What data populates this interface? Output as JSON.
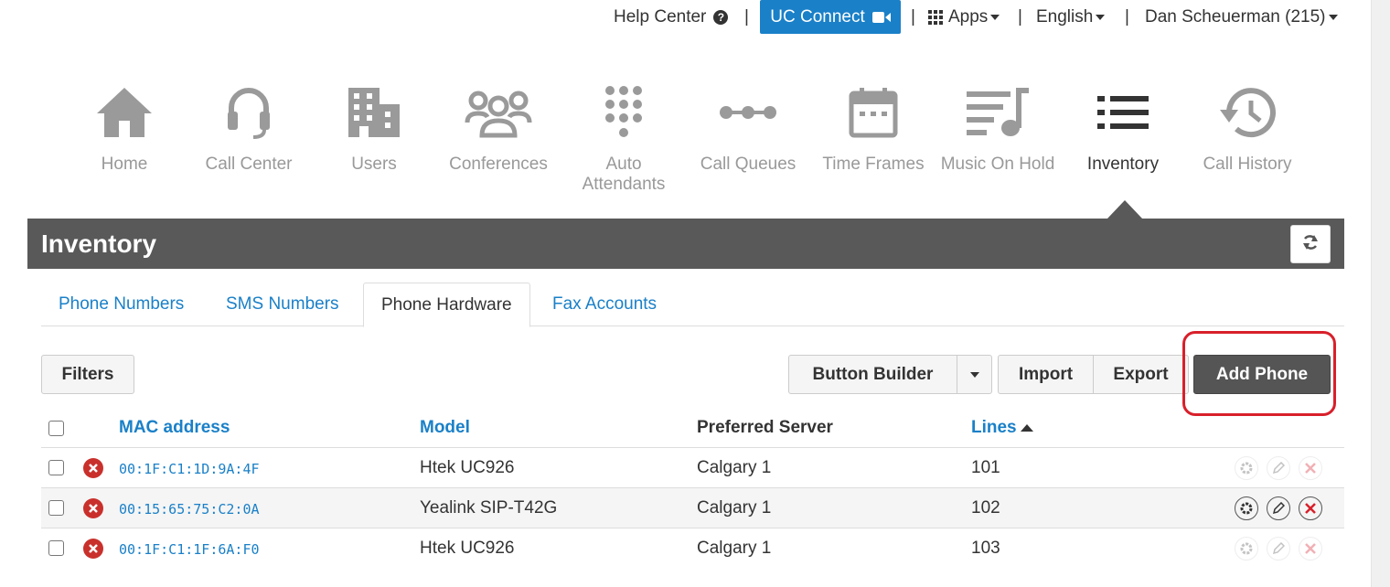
{
  "topbar": {
    "help_center": "Help Center",
    "uc_connect": "UC Connect",
    "apps": "Apps",
    "language": "English",
    "user": "Dan Scheuerman (215)",
    "separator": "|"
  },
  "nav": {
    "items": [
      {
        "label": "Home",
        "icon": "home-icon"
      },
      {
        "label": "Call Center",
        "icon": "headset-icon"
      },
      {
        "label": "Users",
        "icon": "building-icon"
      },
      {
        "label": "Conferences",
        "icon": "group-icon"
      },
      {
        "label": "Auto Attendants",
        "icon": "keypad-icon"
      },
      {
        "label": "Call Queues",
        "icon": "queue-icon"
      },
      {
        "label": "Time Frames",
        "icon": "calendar-icon"
      },
      {
        "label": "Music On Hold",
        "icon": "music-icon"
      },
      {
        "label": "Inventory",
        "icon": "list-icon",
        "active": true
      },
      {
        "label": "Call History",
        "icon": "history-icon"
      }
    ]
  },
  "page": {
    "title": "Inventory"
  },
  "tabs": [
    {
      "label": "Phone Numbers"
    },
    {
      "label": "SMS Numbers"
    },
    {
      "label": "Phone Hardware",
      "active": true
    },
    {
      "label": "Fax Accounts"
    }
  ],
  "toolbar": {
    "filters": "Filters",
    "button_builder": "Button Builder",
    "import": "Import",
    "export": "Export",
    "add_phone": "Add Phone"
  },
  "table": {
    "columns": {
      "mac": "MAC address",
      "model": "Model",
      "server": "Preferred Server",
      "lines": "Lines"
    },
    "rows": [
      {
        "mac": "00:1F:C1:1D:9A:4F",
        "model": "Htek UC926",
        "server": "Calgary 1",
        "lines": "101"
      },
      {
        "mac": "00:15:65:75:C2:0A",
        "model": "Yealink SIP-T42G",
        "server": "Calgary 1",
        "lines": "102"
      },
      {
        "mac": "00:1F:C1:1F:6A:F0",
        "model": "Htek UC926",
        "server": "Calgary 1",
        "lines": "103"
      }
    ]
  },
  "colors": {
    "accent": "#1a80c8",
    "header_bg": "#595959",
    "highlight": "#d8202b",
    "error": "#c9302c"
  }
}
